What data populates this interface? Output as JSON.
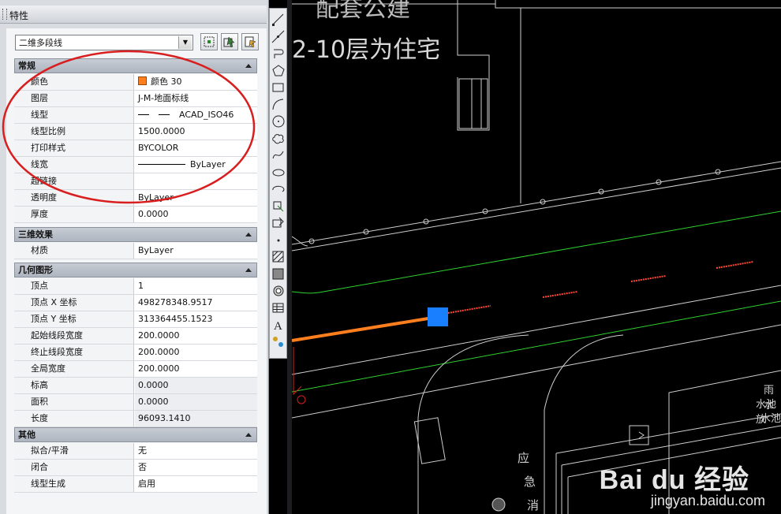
{
  "palette": {
    "title": "特性",
    "object_type": "二维多段线",
    "sections": [
      {
        "title": "常规",
        "rows": [
          {
            "label": "颜色",
            "value": "颜色 30"
          },
          {
            "label": "图层",
            "value": "J-M-地面标线"
          },
          {
            "label": "线型",
            "value": "ACAD_ISO46"
          },
          {
            "label": "线型比例",
            "value": "1500.0000"
          },
          {
            "label": "打印样式",
            "value": "BYCOLOR"
          },
          {
            "label": "线宽",
            "value": "ByLayer"
          },
          {
            "label": "超链接",
            "value": ""
          },
          {
            "label": "透明度",
            "value": "ByLayer"
          },
          {
            "label": "厚度",
            "value": "0.0000"
          }
        ]
      },
      {
        "title": "三维效果",
        "rows": [
          {
            "label": "材质",
            "value": "ByLayer"
          }
        ]
      },
      {
        "title": "几何图形",
        "rows": [
          {
            "label": "顶点",
            "value": "1"
          },
          {
            "label": "顶点 X 坐标",
            "value": "498278348.9517"
          },
          {
            "label": "顶点 Y 坐标",
            "value": "313364455.1523"
          },
          {
            "label": "起始线段宽度",
            "value": "200.0000"
          },
          {
            "label": "终止线段宽度",
            "value": "200.0000"
          },
          {
            "label": "全局宽度",
            "value": "200.0000"
          },
          {
            "label": "标高",
            "value": "0.0000"
          },
          {
            "label": "面积",
            "value": "0.0000"
          },
          {
            "label": "长度",
            "value": "96093.1410"
          }
        ]
      },
      {
        "title": "其他",
        "rows": [
          {
            "label": "拟合/平滑",
            "value": "无"
          },
          {
            "label": "闭合",
            "value": "否"
          },
          {
            "label": "线型生成",
            "value": "启用"
          }
        ]
      }
    ],
    "color_swatch": "#ff7f1f"
  },
  "canvas": {
    "text_top": "2-10层为住宅",
    "text_cut": "配套公建",
    "label_right_1": "雨水",
    "label_right_2": "水池放",
    "label_right_3": "水池",
    "label_road_1": "应",
    "label_road_2": "急",
    "label_road_3": "消",
    "grip_color": "#1a7fff",
    "polyline_color": "#ff7f1f",
    "green_line_color": "#2fd12f"
  },
  "watermark": {
    "brand": "Bai du 经验",
    "url": "jingyan.baidu.com"
  },
  "annotation_color": "#d81e1e"
}
